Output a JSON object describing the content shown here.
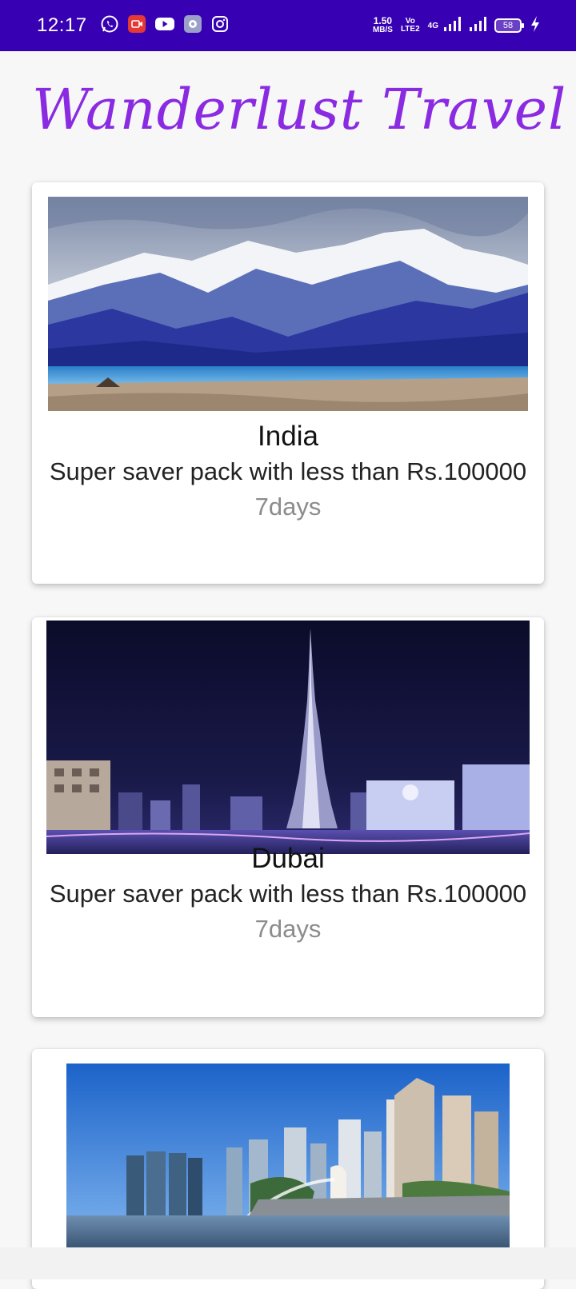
{
  "status_bar": {
    "time": "12:17",
    "speed_value": "1.50",
    "speed_unit": "MB/S",
    "volte_top": "Vo",
    "volte_bottom": "LTE2",
    "network": "4G",
    "battery": "58",
    "app_icons": [
      "whatsapp-icon",
      "screen-recorder-icon",
      "youtube-icon",
      "settings-app-icon",
      "instagram-icon"
    ]
  },
  "header": {
    "title": "Wanderlust Travel"
  },
  "destinations": [
    {
      "name": "India",
      "description": "Super saver pack with less than Rs.100000",
      "duration": "7days",
      "image": "mountain-lake-photo"
    },
    {
      "name": "Dubai",
      "description": "Super saver pack with less than Rs.100000",
      "duration": "7days",
      "image": "night-skyline-photo"
    },
    {
      "name": "",
      "description": "",
      "duration": "",
      "image": "singapore-skyline-photo"
    }
  ],
  "colors": {
    "status_bar": "#3700b3",
    "title": "#8a2be2",
    "background": "#f7f7f7"
  }
}
